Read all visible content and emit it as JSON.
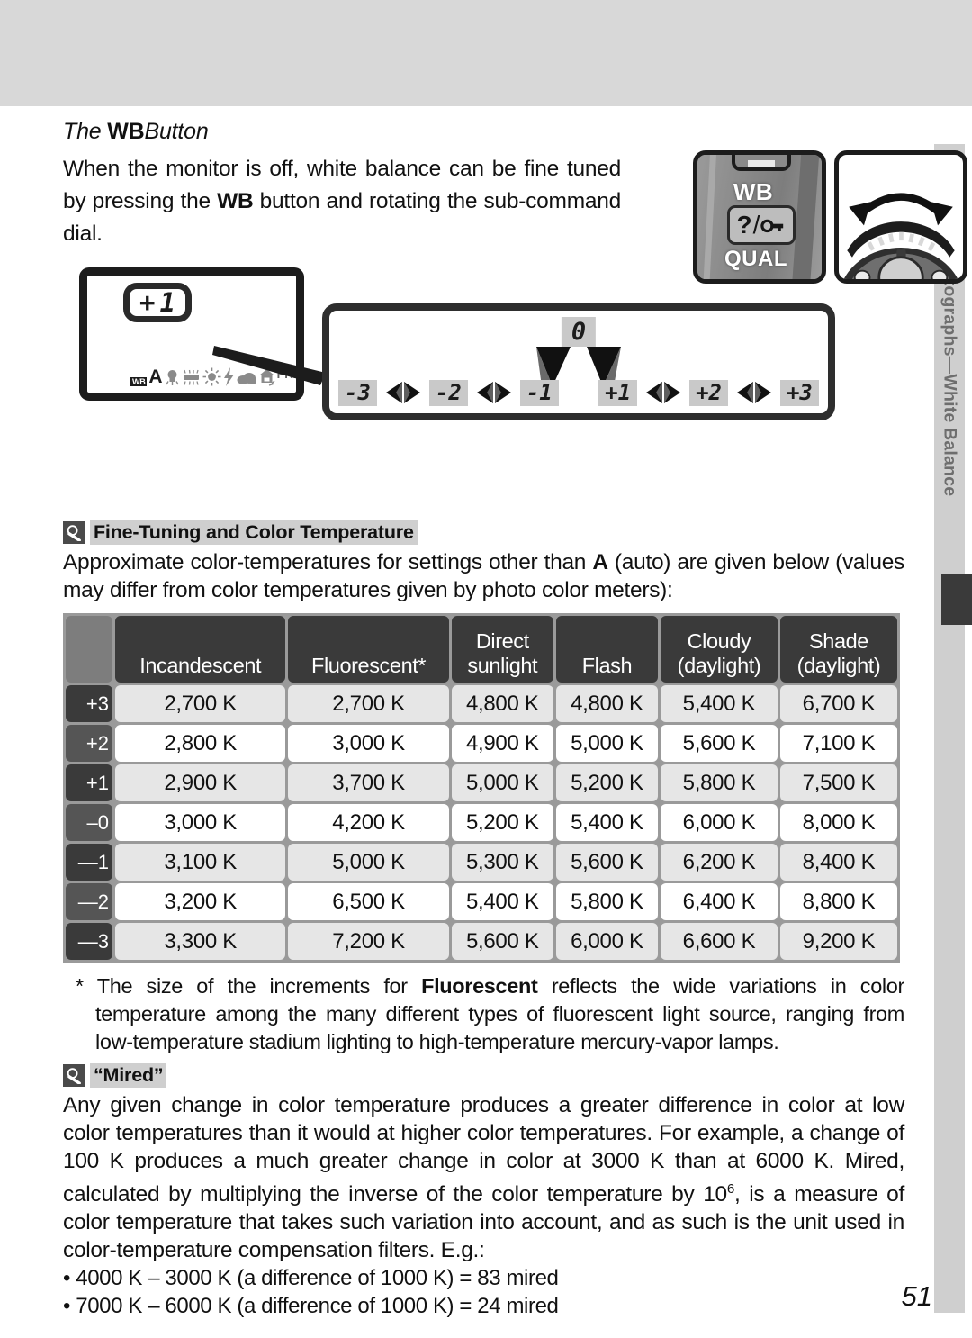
{
  "page": {
    "number": "51",
    "sidebar": {
      "icon": "camera-icon",
      "text": "Taking Photographs—White Balance"
    }
  },
  "section": {
    "title_lead": "The ",
    "title_bold": "WB",
    "title_tail": "Button",
    "intro_1": "When the monitor is off, white balance can be fine tuned by pressing the ",
    "intro_bold": "WB",
    "intro_2": " button and rotating the sub-command dial."
  },
  "camera_art": {
    "wb_label": "WB",
    "qual_label": "QUAL",
    "key_question": "?",
    "key_slash": "/",
    "key_lock_icon": "lock-icon",
    "dial_icon": "command-dial-icon",
    "rotate_arrow_icon": "rotate-arrow-icon"
  },
  "lcd": {
    "value_sign": "+",
    "value_digit": "1",
    "wb_badge": "WB",
    "mode_letter": "A",
    "pre_label": "PRE",
    "icons": [
      "wb-badge-icon",
      "auto-a-label",
      "incandescent-icon",
      "fluorescent-icon",
      "direct-sunlight-icon",
      "flash-icon",
      "cloudy-icon",
      "shade-icon",
      "pre-label"
    ]
  },
  "scale": {
    "center": "0",
    "ticks": [
      "-3",
      "-2",
      "-1",
      "+1",
      "+2",
      "+3"
    ]
  },
  "tip1": {
    "icon": "magnifier-icon",
    "heading": "Fine-Tuning and Color Temperature",
    "body_1": "Approximate color-temperatures for settings other than ",
    "body_bold": "A",
    "body_2": " (auto) are given below (values may differ from color temperatures given by photo color meters):"
  },
  "table": {
    "corner": "",
    "columns": [
      {
        "line1": "",
        "line2": "Incandescent"
      },
      {
        "line1": "",
        "line2": "Fluorescent*"
      },
      {
        "line1": "Direct",
        "line2": "sunlight"
      },
      {
        "line1": "",
        "line2": "Flash"
      },
      {
        "line1": "Cloudy",
        "line2": "(daylight)"
      },
      {
        "line1": "Shade",
        "line2": "(daylight)"
      }
    ],
    "rows": [
      {
        "label": "+3",
        "shade": "dark",
        "values": [
          "2,700 K",
          "2,700 K",
          "4,800 K",
          "4,800 K",
          "5,400 K",
          "6,700 K"
        ]
      },
      {
        "label": "+2",
        "shade": "light",
        "values": [
          "2,800 K",
          "3,000 K",
          "4,900 K",
          "5,000 K",
          "5,600 K",
          "7,100 K"
        ]
      },
      {
        "label": "+1",
        "shade": "dark",
        "values": [
          "2,900 K",
          "3,700 K",
          "5,000 K",
          "5,200 K",
          "5,800 K",
          "7,500 K"
        ]
      },
      {
        "label": "–0",
        "shade": "light",
        "values": [
          "3,000 K",
          "4,200 K",
          "5,200 K",
          "5,400 K",
          "6,000 K",
          "8,000 K"
        ]
      },
      {
        "label": "—1",
        "shade": "dark",
        "values": [
          "3,100 K",
          "5,000 K",
          "5,300 K",
          "5,600 K",
          "6,200 K",
          "8,400 K"
        ]
      },
      {
        "label": "—2",
        "shade": "light",
        "values": [
          "3,200 K",
          "6,500 K",
          "5,400 K",
          "5,800 K",
          "6,400 K",
          "8,800 K"
        ]
      },
      {
        "label": "—3",
        "shade": "dark",
        "values": [
          "3,300 K",
          "7,200 K",
          "5,600 K",
          "6,000 K",
          "6,600 K",
          "9,200 K"
        ]
      }
    ]
  },
  "footnote": {
    "marker": "*",
    "text_1": " The size of the increments for ",
    "text_bold": "Fluorescent",
    "text_2": " reflects the wide variations in color temperature among the many different types of fluorescent light source, ranging from low-temperature stadium lighting to high-temperature mercury-vapor lamps."
  },
  "tip2": {
    "icon": "magnifier-icon",
    "heading": "“Mired”",
    "body_1": "Any given change in color temperature produces a greater difference in color at low color temperatures than it would at higher color temperatures.  For example, a change of 100 K produces a much greater change in color at 3000 K than at 6000 K.  Mired, calculated by multiplying the inverse of the color temperature by 10",
    "exponent": "6",
    "body_2": ", is a measure of color temperature that takes such variation into account, and as such is the unit used in color-temperature compensation filters.  E.g.:",
    "bullets": [
      "• 4000 K – 3000 K (a difference of 1000 K) = 83 mired",
      "• 7000 K – 6000 K (a difference of 1000 K) = 24 mired"
    ]
  },
  "colors": {
    "band": "#d8d8d8",
    "rail": "#cfcfcf",
    "header_cell": "#3a3a3a",
    "row_dark": "#e6e6e6",
    "row_light": "#ffffff",
    "grid": "#9a9a9a"
  }
}
